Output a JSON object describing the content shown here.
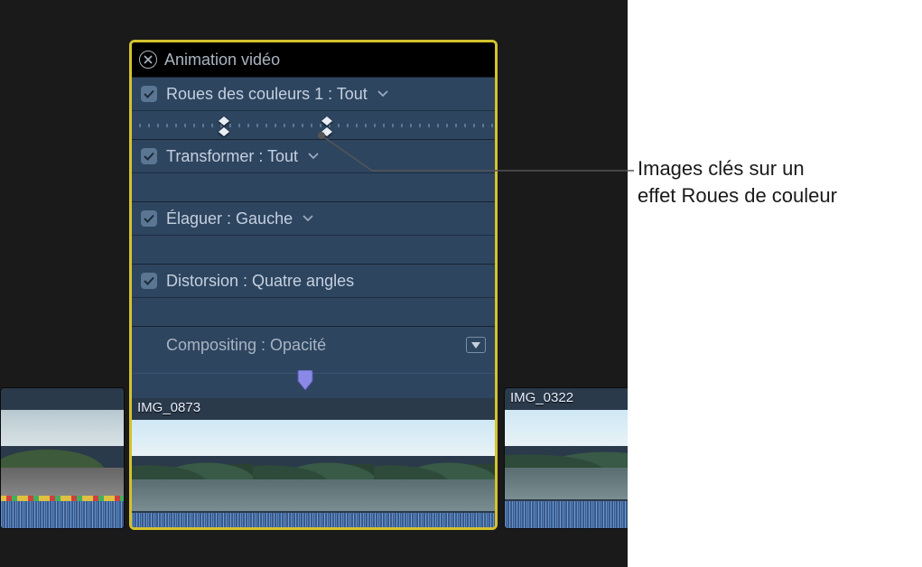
{
  "panel": {
    "title": "Animation vidéo",
    "rows": [
      {
        "label": "Roues des couleurs 1 : Tout",
        "hasChevron": true,
        "hasKeyframes": true,
        "checked": true
      },
      {
        "label": "Transformer : Tout",
        "hasChevron": true,
        "hasKeyframes": false,
        "checked": true
      },
      {
        "label": "Élaguer : Gauche",
        "hasChevron": true,
        "hasKeyframes": false,
        "checked": true
      },
      {
        "label": "Distorsion : Quatre angles",
        "hasChevron": false,
        "hasKeyframes": false,
        "checked": true
      }
    ],
    "compositing": {
      "label": "Compositing : Opacité"
    },
    "keyframePositions": [
      102,
      216
    ]
  },
  "clips": {
    "left": "",
    "center": "IMG_0873",
    "right": "IMG_0322"
  },
  "callout": {
    "line1": "Images clés sur un",
    "line2": "effet Roues de couleur"
  },
  "colors": {
    "selection": "#d4c22e",
    "panel": "#2e4560",
    "playhead": "#8a8ae6"
  }
}
